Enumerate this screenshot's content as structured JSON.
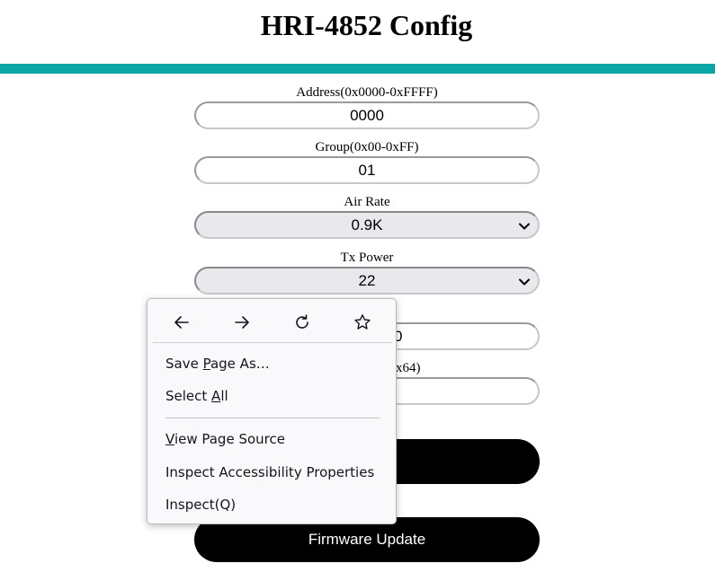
{
  "page": {
    "title": "HRI-4852 Config"
  },
  "form": {
    "address": {
      "label": "Address(0x0000-0xFFFF)",
      "value": "0000"
    },
    "group": {
      "label": "Group(0x00-0xFF)",
      "value": "01"
    },
    "air_rate": {
      "label": "Air Rate",
      "value": "0.9K"
    },
    "tx_power": {
      "label": "Tx Power",
      "value": "22"
    },
    "hidden_field_1": {
      "value_visible": "0"
    },
    "hidden_field_2": {
      "label_visible": "x64)"
    },
    "firmware_update_label": "Firmware Update"
  },
  "context_menu": {
    "nav": {
      "back_icon": "arrow-left-icon",
      "forward_icon": "arrow-right-icon",
      "reload_icon": "reload-icon",
      "bookmark_icon": "star-icon"
    },
    "items": {
      "save_page_as": {
        "pre": "Save ",
        "key": "P",
        "post": "age As…"
      },
      "select_all": {
        "pre": "Select ",
        "key": "A",
        "post": "ll"
      },
      "view_page_source": {
        "pre": "",
        "key": "V",
        "post": "iew Page Source"
      },
      "inspect_accessibility": "Inspect Accessibility Properties",
      "inspect": "Inspect(Q)"
    }
  },
  "colors": {
    "accent_bar": "#0aa6a6",
    "button_bg": "#000000",
    "button_text": "#ffffff",
    "select_bg": "#e9e9ed",
    "menu_bg": "#f9f9fb"
  }
}
